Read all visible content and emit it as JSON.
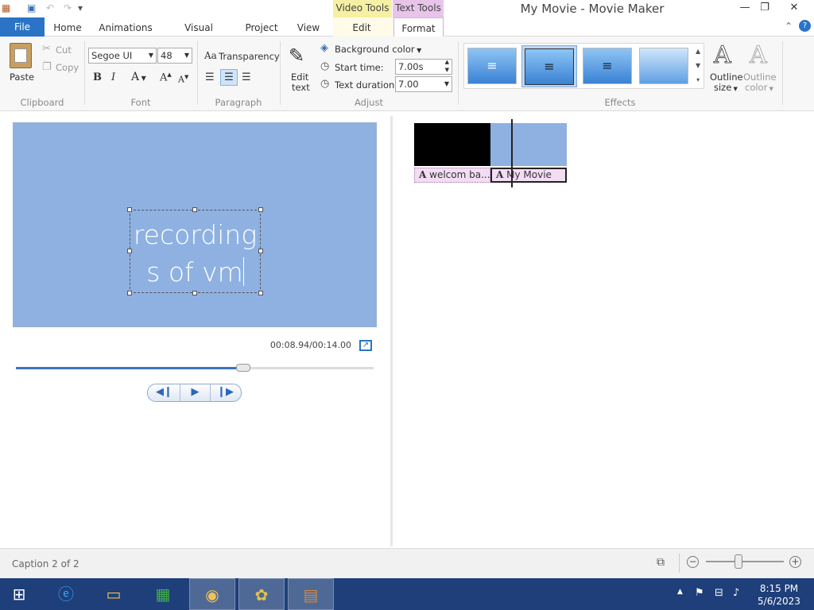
{
  "window": {
    "title": "My Movie - Movie Maker",
    "context_tabs": {
      "video_tools": "Video Tools",
      "text_tools": "Text Tools"
    },
    "controls": {
      "minimize": "—",
      "restore": "❐",
      "close": "✕"
    }
  },
  "tabs": {
    "file": "File",
    "home": "Home",
    "animations": "Animations",
    "visual_effects": "Visual Effects",
    "project": "Project",
    "view": "View",
    "edit": "Edit",
    "format": "Format"
  },
  "ribbon": {
    "clipboard": {
      "paste": "Paste",
      "cut": "Cut",
      "copy": "Copy",
      "group": "Clipboard"
    },
    "font": {
      "family": "Segoe UI",
      "size": "48",
      "transparency": "Transparency",
      "group": "Font"
    },
    "paragraph": {
      "group": "Paragraph"
    },
    "adjust": {
      "edit_text_line1": "Edit",
      "edit_text_line2": "text",
      "background_color": "Background color",
      "start_time_label": "Start time:",
      "start_time_value": "7.00s",
      "text_duration_label": "Text duration:",
      "text_duration_value": "7.00",
      "group": "Adjust"
    },
    "effects": {
      "group": "Effects",
      "outline_size_line1": "Outline",
      "outline_size_line2": "size",
      "outline_color_line1": "Outline",
      "outline_color_line2": "color"
    }
  },
  "preview": {
    "caption_line1": "recording",
    "caption_line2": "s of vm",
    "timecode": "00:08.94/00:14.00",
    "progress": 0.635
  },
  "storyboard": {
    "captions": [
      "welcom ba...",
      "My Movie"
    ]
  },
  "status": {
    "text": "Caption 2 of 2"
  },
  "taskbar": {
    "time": "8:15 PM",
    "date": "5/6/2023"
  },
  "colors": {
    "accent": "#2a73c7",
    "preview_bg": "#8eb1e2",
    "taskbar": "#1e3f7a"
  }
}
